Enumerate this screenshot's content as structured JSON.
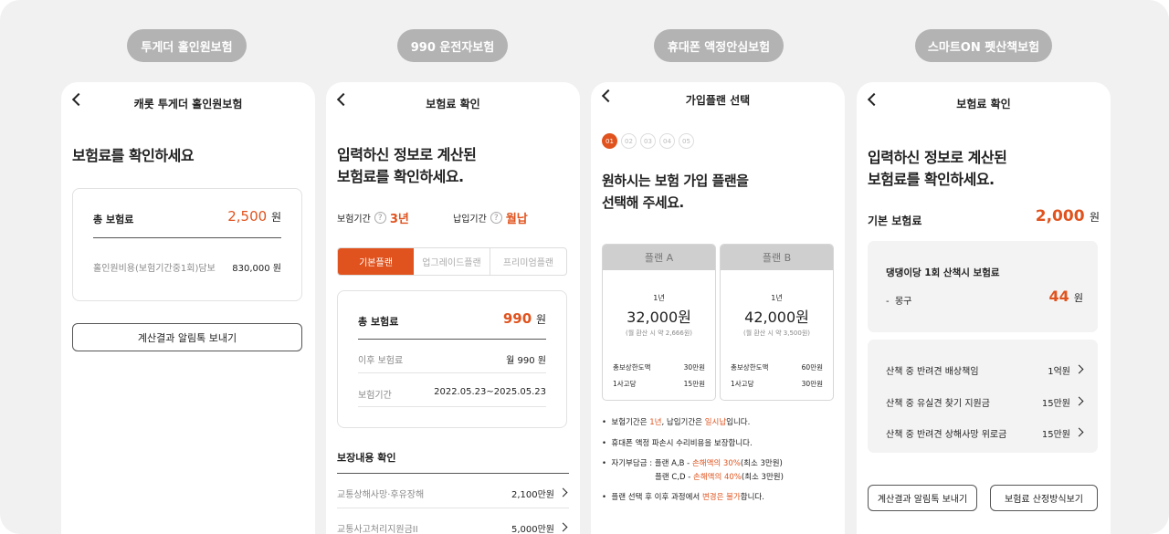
{
  "pills": [
    "투게더 홀인원보험",
    "990 운전자보험",
    "휴대폰 액정안심보험",
    "스마트ON 펫산책보험"
  ],
  "s1": {
    "title": "캐롯 투게더 홀인원보험",
    "heading": "보험료를 확인하세요",
    "total_label": "총 보험료",
    "total_value": "2,500",
    "unit": "원",
    "item_label": "홀인원비용(보험기간중1회)담보",
    "item_value": "830,000 원",
    "send_button": "계산결과 알림톡 보내기"
  },
  "s2": {
    "title": "보험료 확인",
    "heading1": "입력하신 정보로 계산된",
    "heading2": "보험료를 확인하세요.",
    "period_label": "보험기간",
    "period_value": "3년",
    "pay_label": "납입기간",
    "pay_value": "월납",
    "tabs": [
      "기본플랜",
      "업그레이드플랜",
      "프리미엄플랜"
    ],
    "total_label": "총 보험료",
    "total_value": "990",
    "unit": "원",
    "after_label": "이후 보험료",
    "after_value": "월 990 원",
    "term_label": "보험기간",
    "term_value": "2022.05.23~2025.05.23",
    "coverage_title": "보장내용 확인",
    "coverage": [
      {
        "label": "교통상해사망·후유장해",
        "value": "2,100만원"
      },
      {
        "label": "교통사고처리지원금II",
        "value": "5,000만원"
      }
    ]
  },
  "s3": {
    "title": "가입플랜 선택",
    "steps": [
      "01",
      "02",
      "03",
      "04",
      "05"
    ],
    "heading1": "원하시는 보험 가입 플랜을",
    "heading2": "선택해 주세요.",
    "plans": [
      {
        "name": "플랜 A",
        "years": "1년",
        "price": "32,000원",
        "monthly": "(월 환산 시 약 2,666원)",
        "row1_label": "총보상한도액",
        "row1_value": "30만원",
        "row2_label": "1사고당",
        "row2_value": "15만원"
      },
      {
        "name": "플랜 B",
        "years": "1년",
        "price": "42,000원",
        "monthly": "(월 환산 시 약 3,500원)",
        "row1_label": "총보상한도액",
        "row1_value": "60만원",
        "row2_label": "1사고당",
        "row2_value": "30만원"
      }
    ],
    "note1_a": "보험기간은 ",
    "note1_b": "1년",
    "note1_c": ", 납입기간은 ",
    "note1_d": "일시납",
    "note1_e": "입니다.",
    "note2": "휴대폰 액정 파손시 수리비용을 보장합니다.",
    "note3_a": "자기부담금 : 플랜 A,B - ",
    "note3_b": "손해액의 30%",
    "note3_c": "(최소 3만원)",
    "note3_d": "플랜 C,D - ",
    "note3_e": "손해액의 40%",
    "note3_f": "(최소 3만원)",
    "note4_a": "플랜 선택 후 이후 과정에서 ",
    "note4_b": "변경은 불가",
    "note4_c": "합니다."
  },
  "s4": {
    "title": "보험료 확인",
    "heading1": "입력하신 정보로 계산된",
    "heading2": "보험료를 확인하세요.",
    "base_label": "기본 보험료",
    "base_value": "2,000",
    "unit": "원",
    "product": "댕댕이당 1회 산책시 보험료",
    "item_label": "몽구",
    "item_value": "44",
    "items": [
      {
        "label": "산책 중 반려견 배상책임",
        "value": "1억원"
      },
      {
        "label": "산책 중 유실견 찾기 지원금",
        "value": "15만원"
      },
      {
        "label": "산책 중 반려견 상해사망 위로금",
        "value": "15만원"
      }
    ],
    "send_button": "계산결과 알림톡 보내기",
    "method_button": "보험료 산정방식보기"
  },
  "colors": {
    "accent": "#e0531e",
    "pill": "#b3b3b3",
    "board": "#f1f1f1"
  }
}
